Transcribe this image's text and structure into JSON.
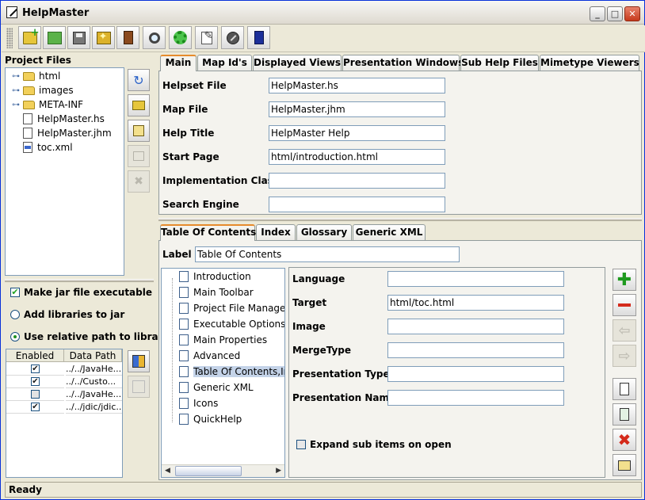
{
  "window": {
    "title": "HelpMaster",
    "app_icon": "helpmaster-icon",
    "controls": [
      "minimize-icon",
      "maximize-icon",
      "close-icon"
    ]
  },
  "toolbar": {
    "buttons": [
      {
        "icon": "new-folder-icon"
      },
      {
        "icon": "open-folder-icon"
      },
      {
        "icon": "save-icon"
      },
      {
        "icon": "new-project-icon"
      },
      {
        "icon": "exit-door-icon"
      },
      {
        "icon": "search-icon"
      },
      {
        "icon": "settings-gear-icon"
      },
      {
        "icon": "edit-icon"
      },
      {
        "icon": "stop-icon"
      },
      {
        "icon": "help-book-icon"
      }
    ]
  },
  "project_files": {
    "label": "Project Files",
    "items": [
      {
        "name": "html",
        "type": "folder"
      },
      {
        "name": "images",
        "type": "folder"
      },
      {
        "name": "META-INF",
        "type": "folder"
      },
      {
        "name": "HelpMaster.hs",
        "type": "file"
      },
      {
        "name": "HelpMaster.jhm",
        "type": "file"
      },
      {
        "name": "toc.xml",
        "type": "file"
      }
    ]
  },
  "options": {
    "make_jar_executable": "Make jar file executable",
    "add_libraries": "Add libraries to jar",
    "use_relative_path": "Use relative path to libraries"
  },
  "libraries": {
    "columns": [
      "Enabled",
      "Data Path"
    ],
    "rows": [
      {
        "enabled": true,
        "path": "../../JavaHe..."
      },
      {
        "enabled": true,
        "path": "../../Custo..."
      },
      {
        "enabled": false,
        "path": "../../JavaHe..."
      },
      {
        "enabled": true,
        "path": "../../jdic/jdic..."
      }
    ]
  },
  "main_tabs": [
    "Main",
    "Map Id's",
    "Displayed Views",
    "Presentation Windows",
    "Sub Help Files",
    "Mimetype Viewers"
  ],
  "main_form": {
    "helpset_file": {
      "label": "Helpset File",
      "value": "HelpMaster.hs"
    },
    "map_file": {
      "label": "Map File",
      "value": "HelpMaster.jhm"
    },
    "help_title": {
      "label": "Help Title",
      "value": "HelpMaster Help"
    },
    "start_page": {
      "label": "Start Page",
      "value": "html/introduction.html"
    },
    "implementation_class": {
      "label": "Implementation Class",
      "value": ""
    },
    "search_engine": {
      "label": "Search Engine",
      "value": ""
    }
  },
  "view_tabs": [
    "Table Of Contents",
    "Index",
    "Glossary",
    "Generic XML"
  ],
  "toc": {
    "label_caption": "Label",
    "label_value": "Table Of Contents",
    "items": [
      "Introduction",
      "Main Toolbar",
      "Project File Manager",
      "Executable Options",
      "Main Properties",
      "Advanced",
      "Table Of Contents,Inc",
      "Generic XML",
      "Icons",
      "QuickHelp"
    ],
    "selected_index": 6
  },
  "toc_form": {
    "language": {
      "label": "Language",
      "value": ""
    },
    "target": {
      "label": "Target",
      "value": "html/toc.html"
    },
    "image": {
      "label": "Image",
      "value": ""
    },
    "merge_type": {
      "label": "MergeType",
      "value": ""
    },
    "presentation_type": {
      "label": "Presentation Type",
      "value": ""
    },
    "presentation_name": {
      "label": "Presentation Name",
      "value": ""
    },
    "expand_sub_items": "Expand sub items on open"
  },
  "status": {
    "text": "Ready"
  }
}
